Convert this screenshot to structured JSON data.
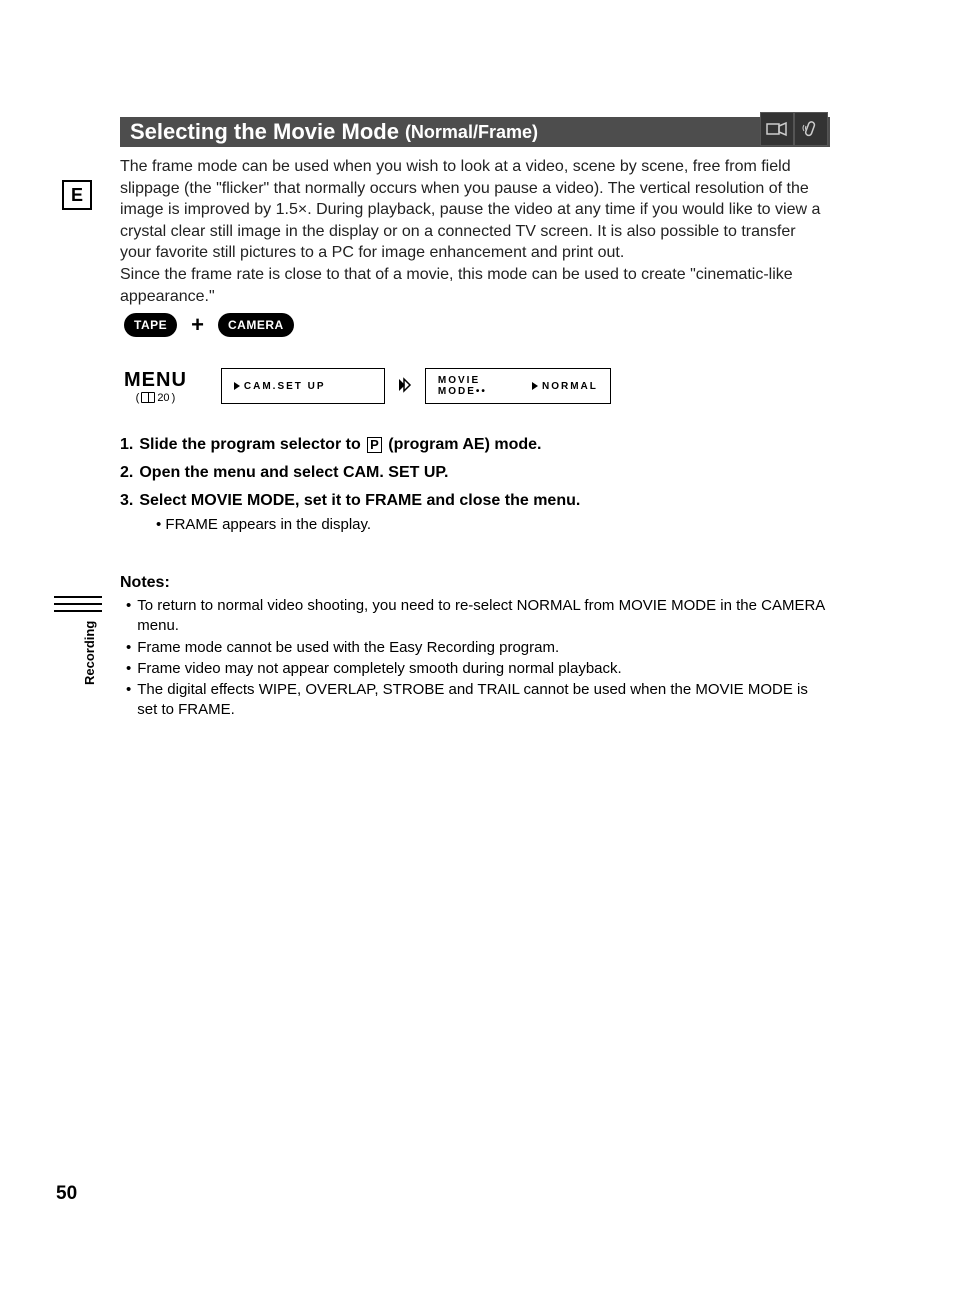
{
  "title": {
    "main": "Selecting the Movie Mode",
    "sub": "(Normal/Frame)"
  },
  "badge": "E",
  "intro": {
    "p1": "The frame mode can be used when you wish to look at a video, scene by scene, free from field slippage (the \"flicker\" that normally occurs when you pause a video). The vertical resolution of the image is improved by 1.5×. During playback, pause the video at any time if you would like to view a crystal clear still image in the display or on a connected TV screen. It is also possible to transfer your favorite still pictures to a PC for image enhancement and print out.",
    "p2": "Since the frame rate is close to that of a movie, this mode can be used to create \"cinematic-like appearance.\""
  },
  "mode": {
    "tape": "TAPE",
    "plus": "+",
    "camera": "CAMERA"
  },
  "menu": {
    "label": "MENU",
    "ref_page": "20",
    "box1": "CAM.SET UP",
    "box2a": "MOVIE MODE••",
    "box2b": "NORMAL"
  },
  "steps": {
    "s1_num": "1.",
    "s1_a": "Slide the program selector to ",
    "s1_b": " (program AE) mode.",
    "p_symbol": "P",
    "s2_num": "2.",
    "s2": "Open the menu and select CAM. SET UP.",
    "s3_num": "3.",
    "s3": "Select MOVIE MODE, set it to FRAME and close the menu.",
    "s3_sub": "• FRAME appears in the display."
  },
  "notes": {
    "title": "Notes:",
    "n1": "To return to normal video shooting, you need to re-select NORMAL from MOVIE MODE in the CAMERA menu.",
    "n2": "Frame mode cannot be used with the Easy Recording program.",
    "n3": "Frame video may not appear completely smooth during normal playback.",
    "n4": "The digital effects WIPE, OVERLAP, STROBE and TRAIL cannot be used when the MOVIE MODE is set to FRAME."
  },
  "side_label": "Recording",
  "page_number": "50"
}
